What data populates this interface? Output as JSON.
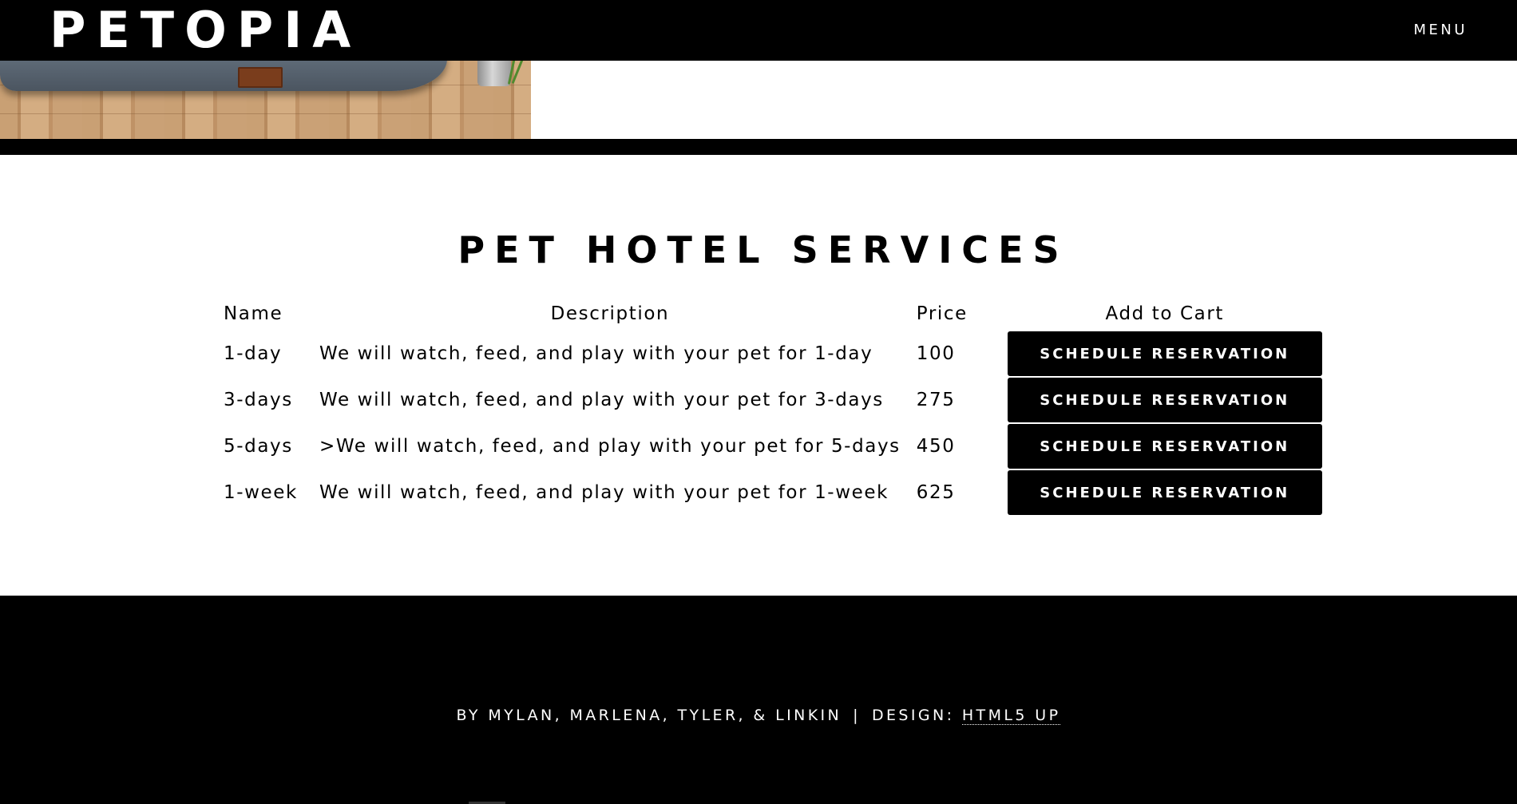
{
  "header": {
    "logo": "PETOPIA",
    "menu_label": "MENU"
  },
  "hero": {
    "image_icon": "pet-bed-photo"
  },
  "services": {
    "title": "PET HOTEL SERVICES",
    "columns": {
      "name": "Name",
      "description": "Description",
      "price": "Price",
      "cart": "Add to Cart"
    },
    "rows": [
      {
        "name": "1-day",
        "description": "We will watch, feed, and play with your pet for 1-day",
        "price": "100",
        "button_label": "SCHEDULE RESERVATION"
      },
      {
        "name": "3-days",
        "description": "We will watch, feed, and play with your pet for 3-days",
        "price": "275",
        "button_label": "SCHEDULE RESERVATION"
      },
      {
        "name": "5-days",
        "description": ">We will watch, feed, and play with your pet for 5-days",
        "price": "450",
        "button_label": "SCHEDULE RESERVATION"
      },
      {
        "name": "1-week",
        "description": "We will watch, feed, and play with your pet for 1-week",
        "price": "625",
        "button_label": "SCHEDULE RESERVATION"
      }
    ]
  },
  "footer": {
    "credits": "BY MYLAN, MARLENA, TYLER, & LINKIN",
    "separator": "|",
    "design_label": "DESIGN:",
    "design_link": "HTML5 UP"
  },
  "colors": {
    "background": "#ffffff",
    "header_bg": "#000000",
    "footer_bg": "#000000",
    "button_bg": "#000000",
    "button_text": "#ffffff"
  }
}
